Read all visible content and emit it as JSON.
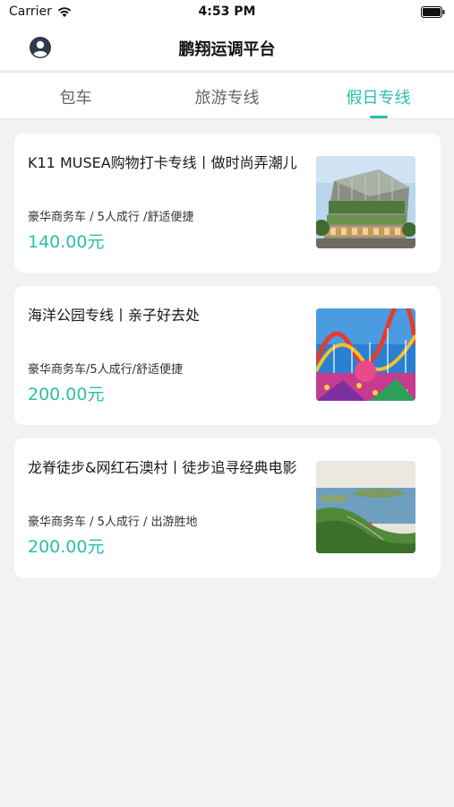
{
  "status": {
    "carrier": "Carrier",
    "time": "4:53 PM"
  },
  "nav": {
    "title": "鹏翔运调平台",
    "user_icon": "user-avatar-icon"
  },
  "tabs": [
    {
      "label": "包车",
      "active": false
    },
    {
      "label": "旅游专线",
      "active": false
    },
    {
      "label": "假日专线",
      "active": true
    }
  ],
  "colors": {
    "accent": "#2bbfa6",
    "background": "#f2f2f2",
    "card": "#ffffff"
  },
  "routes": [
    {
      "title": "K11 MUSEA购物打卡专线丨做时尚弄潮儿",
      "subtitle": "豪华商务车 / 5人成行 /舒适便捷",
      "price": "140.00元",
      "image": "mall-building-image"
    },
    {
      "title": "海洋公园专线丨亲子好去处",
      "subtitle": "豪华商务车/5人成行/舒适便捷",
      "price": "200.00元",
      "image": "roller-coaster-image"
    },
    {
      "title": "龙脊徒步&网红石澳村丨徒步追寻经典电影",
      "subtitle": "豪华商务车 / 5人成行 / 出游胜地",
      "price": "200.00元",
      "image": "coastal-hiking-image"
    }
  ]
}
